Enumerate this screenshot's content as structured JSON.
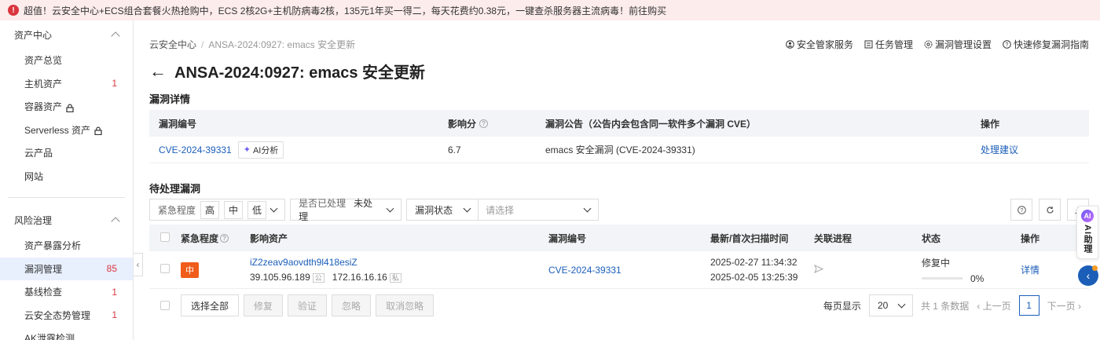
{
  "banner": {
    "icon": "alert-icon",
    "text": "超值！云安全中心+ECS组合套餐火热抢购中，ECS 2核2G+主机防病毒2核，135元1年买一得二，每天花费约0.38元，一键查杀服务器主流病毒！前往购买"
  },
  "sidebar": {
    "group1": "资产中心",
    "items1": [
      {
        "label": "资产总览",
        "count": "",
        "lock": false
      },
      {
        "label": "主机资产",
        "count": "1",
        "lock": false
      },
      {
        "label": "容器资产",
        "count": "",
        "lock": true
      },
      {
        "label": "Serverless 资产",
        "count": "",
        "lock": true
      },
      {
        "label": "云产品",
        "count": "",
        "lock": false
      },
      {
        "label": "网站",
        "count": "",
        "lock": false
      }
    ],
    "group2": "风险治理",
    "items2": [
      {
        "label": "资产暴露分析",
        "count": ""
      },
      {
        "label": "漏洞管理",
        "count": "85"
      },
      {
        "label": "基线检查",
        "count": "1"
      },
      {
        "label": "云安全态势管理",
        "count": "1"
      },
      {
        "label": "AK泄露检测",
        "count": ""
      }
    ]
  },
  "breadcrumb": {
    "root": "云安全中心",
    "sep": "/",
    "current": "ANSA-2024:0927: emacs 安全更新"
  },
  "top_actions": [
    "安全管家服务",
    "任务管理",
    "漏洞管理设置",
    "快速修复漏洞指南"
  ],
  "page_title": "ANSA-2024:0927: emacs 安全更新",
  "detail": {
    "section": "漏洞详情",
    "headers": [
      "漏洞编号",
      "影响分",
      "漏洞公告（公告内会包含同一软件多个漏洞 CVE）",
      "操作"
    ],
    "row": {
      "cve": "CVE-2024-39331",
      "ai_label": "AI分析",
      "score": "6.7",
      "notice": "emacs 安全漏洞 (CVE-2024-39331)",
      "action": "处理建议"
    }
  },
  "pending": {
    "section": "待处理漏洞",
    "filters": {
      "severity_label": "紧急程度",
      "severity_opts": [
        "高",
        "中",
        "低"
      ],
      "handled_label": "是否已处理",
      "handled_value": "未处理",
      "status_label": "漏洞状态",
      "status_placeholder": "请选择"
    },
    "headers": [
      "紧急程度",
      "影响资产",
      "漏洞编号",
      "最新/首次扫描时间",
      "关联进程",
      "状态",
      "操作"
    ],
    "row": {
      "severity": "中",
      "asset_name": "iZ2zeav9aovdth9l418esiZ",
      "ip_public": "39.105.96.189",
      "tag_public": "公",
      "ip_private": "172.16.16.16",
      "tag_private": "私",
      "cve": "CVE-2024-39331",
      "scan_latest": "2025-02-27 11:34:32",
      "scan_first": "2025-02-05 13:25:39",
      "status": "修复中",
      "progress": 0,
      "progress_label": "0%",
      "action": "详情"
    }
  },
  "footer": {
    "select_all": "选择全部",
    "buttons": [
      "修复",
      "验证",
      "忽略",
      "取消忽略"
    ],
    "per_page_label": "每页显示",
    "per_page": "20",
    "total": "共 1 条数据",
    "prev": "上一页",
    "page": "1",
    "next": "下一页"
  },
  "ai_assistant": {
    "logo": "AI",
    "label": "AI助理"
  }
}
